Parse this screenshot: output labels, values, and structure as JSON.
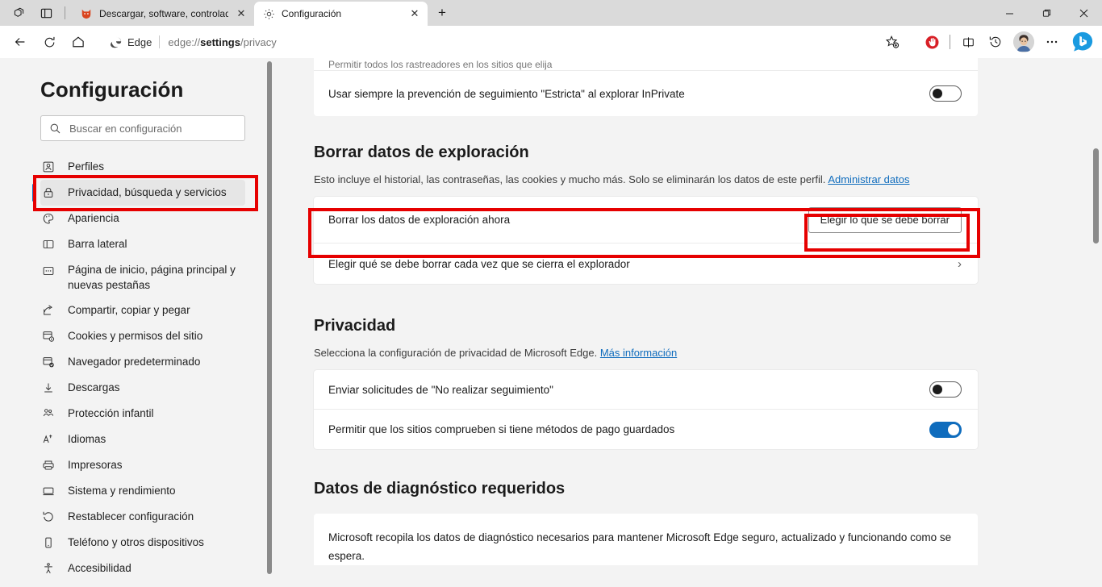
{
  "window": {
    "controls": {
      "minimize": "—",
      "maximize": "❐",
      "close": "✕"
    }
  },
  "tabstrip": {
    "tab_search_icon": "tab-search-icon",
    "tab_list_icon": "split-tabs-icon",
    "new_tab_label": "+",
    "tabs": [
      {
        "title": "Descargar, software, controlador",
        "favicon": "fox-favicon",
        "active": false,
        "close": "✕"
      },
      {
        "title": "Configuración",
        "favicon": "gear-favicon",
        "active": true,
        "close": "✕"
      }
    ]
  },
  "toolbar": {
    "back_icon": "back-arrow-icon",
    "refresh_icon": "refresh-icon",
    "home_icon": "home-icon",
    "edge_label": "Edge",
    "url_prefix": "edge://",
    "url_bold": "settings",
    "url_suffix": "/privacy",
    "favorite_icon": "add-favorite-icon",
    "adblock_icon": "adblock-extension-icon",
    "split_screen_icon": "split-screen-icon",
    "history_icon": "history-icon",
    "profile_icon": "profile-avatar",
    "settings_more_icon": "more-options-icon",
    "copilot_icon": "bing-copilot-icon"
  },
  "sidebar": {
    "title": "Configuración",
    "search": {
      "placeholder": "Buscar en configuración",
      "value": "",
      "icon": "search-icon"
    },
    "items": [
      {
        "label": "Perfiles",
        "icon": "profile-card-icon",
        "selected": false
      },
      {
        "label": "Privacidad, búsqueda y servicios",
        "icon": "lock-icon",
        "selected": true
      },
      {
        "label": "Apariencia",
        "icon": "palette-icon",
        "selected": false
      },
      {
        "label": "Barra lateral",
        "icon": "sidebar-icon",
        "selected": false
      },
      {
        "label": "Página de inicio, página principal y nuevas pestañas",
        "icon": "start-page-icon",
        "selected": false
      },
      {
        "label": "Compartir, copiar y pegar",
        "icon": "share-icon",
        "selected": false
      },
      {
        "label": "Cookies y permisos del sitio",
        "icon": "cookies-icon",
        "selected": false
      },
      {
        "label": "Navegador predeterminado",
        "icon": "default-browser-icon",
        "selected": false
      },
      {
        "label": "Descargas",
        "icon": "download-icon",
        "selected": false
      },
      {
        "label": "Protección infantil",
        "icon": "family-icon",
        "selected": false
      },
      {
        "label": "Idiomas",
        "icon": "language-icon",
        "selected": false
      },
      {
        "label": "Impresoras",
        "icon": "printer-icon",
        "selected": false
      },
      {
        "label": "Sistema y rendimiento",
        "icon": "system-icon",
        "selected": false
      },
      {
        "label": "Restablecer configuración",
        "icon": "reset-icon",
        "selected": false
      },
      {
        "label": "Teléfono y otros dispositivos",
        "icon": "phone-icon",
        "selected": false
      },
      {
        "label": "Accesibilidad",
        "icon": "accessibility-icon",
        "selected": false
      }
    ]
  },
  "main": {
    "clipped_top_row": "Permitir todos los rastreadores en los sitios que elija",
    "inprivate_row": {
      "label": "Usar siempre la prevención de seguimiento \"Estricta\" al explorar InPrivate",
      "toggle_state": "off"
    },
    "clear_section": {
      "title": "Borrar datos de exploración",
      "description": "Esto incluye el historial, las contraseñas, las cookies y mucho más. Solo se eliminarán los datos de este perfil.",
      "description_link": "Administrar datos",
      "row_now_label": "Borrar los datos de exploración ahora",
      "row_now_button": "Elegir lo que se debe borrar",
      "row_onclose_label": "Elegir qué se debe borrar cada vez que se cierra el explorador",
      "row_onclose_chevron": "›"
    },
    "privacy_section": {
      "title": "Privacidad",
      "description": "Selecciona la configuración de privacidad de Microsoft Edge.",
      "description_link": "Más información",
      "rows": [
        {
          "label": "Enviar solicitudes de \"No realizar seguimiento\"",
          "toggle_state": "off"
        },
        {
          "label": "Permitir que los sitios comprueben si tiene métodos de pago guardados",
          "toggle_state": "on"
        }
      ]
    },
    "diagnostics_section": {
      "title": "Datos de diagnóstico requeridos",
      "body": "Microsoft recopila los datos de diagnóstico necesarios para mantener Microsoft Edge seguro, actualizado y funcionando como se espera."
    }
  },
  "highlights": {
    "sidebar_item": "red-highlight-sidebar-privacy",
    "clear_row": "red-highlight-clear-row",
    "clear_button": "red-highlight-clear-button"
  },
  "colors": {
    "accent": "#0f6cbd",
    "highlight": "#e60000",
    "chrome_bg": "#dadada",
    "page_bg": "#f3f3f3"
  }
}
